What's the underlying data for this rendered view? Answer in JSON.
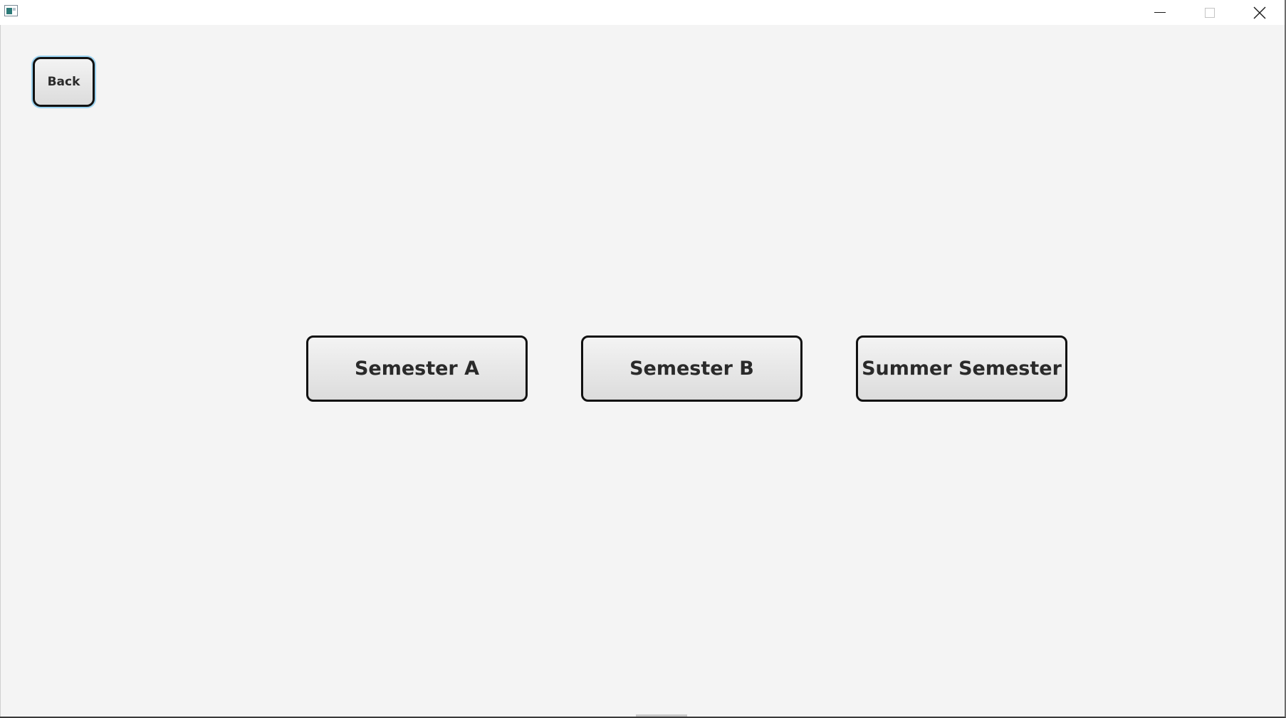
{
  "window": {
    "app_icon": "app-window-icon",
    "controls": {
      "minimize": "minimize-icon",
      "maximize": "maximize-icon",
      "close": "close-icon"
    }
  },
  "main": {
    "back_label": "Back",
    "semesters": [
      {
        "label": "Semester A"
      },
      {
        "label": "Semester B"
      },
      {
        "label": "Summer Semester"
      }
    ]
  },
  "colors": {
    "background": "#f4f4f4",
    "button_border": "#111111",
    "button_text": "#2a2a2a",
    "focus_ring": "#9ad2f0"
  }
}
